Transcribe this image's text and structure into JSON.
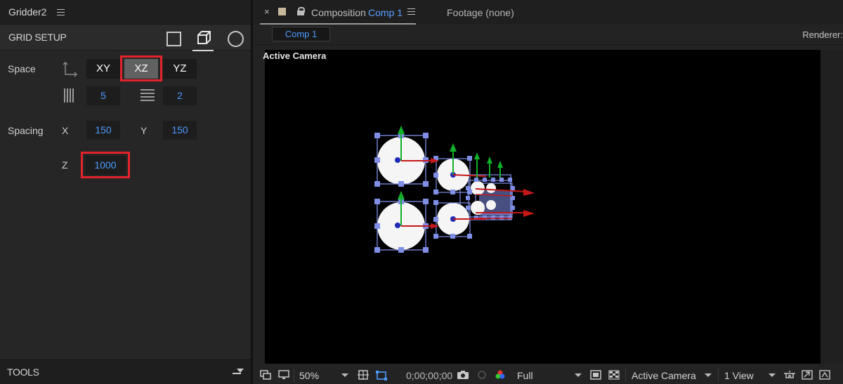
{
  "left_panel": {
    "title": "Gridder2",
    "section_label": "GRID SETUP",
    "space": {
      "label": "Space",
      "planes": [
        "XY",
        "XZ",
        "YZ"
      ],
      "active_plane": "XZ",
      "columns": "5",
      "rows": "2"
    },
    "spacing": {
      "label": "Spacing",
      "x_label": "X",
      "x_value": "150",
      "y_label": "Y",
      "y_value": "150",
      "z_label": "Z",
      "z_value": "1000"
    },
    "tools_label": "TOOLS"
  },
  "composition": {
    "tab_prefix": "Composition",
    "tab_comp_name": "Comp 1",
    "close_glyph": "×",
    "footage_tab": "Footage (none)",
    "comp_chip": "Comp 1",
    "renderer_label": "Renderer:",
    "viewer_label": "Active Camera",
    "toolbar": {
      "zoom": "50%",
      "timecode": "0;00;00;00",
      "resolution": "Full",
      "camera": "Active Camera",
      "views": "1 View"
    }
  },
  "colors": {
    "accent_blue": "#4d9bff",
    "highlight_red": "#e3232c",
    "active_button": "#616161",
    "handle_blue": "#7f8fe8",
    "axis_green": "#11b12a",
    "axis_red": "#c41818"
  },
  "icons": [
    "menu-icon",
    "square-icon",
    "cube-icon",
    "circle-icon",
    "axes-icon",
    "columns-icon",
    "rows-icon",
    "lock-icon",
    "camera-icon",
    "color-channels-icon",
    "grid-icon",
    "mask-icon",
    "region-icon",
    "transparency-icon",
    "3d-glasses-icon",
    "snapshot-icon",
    "export-icon"
  ]
}
